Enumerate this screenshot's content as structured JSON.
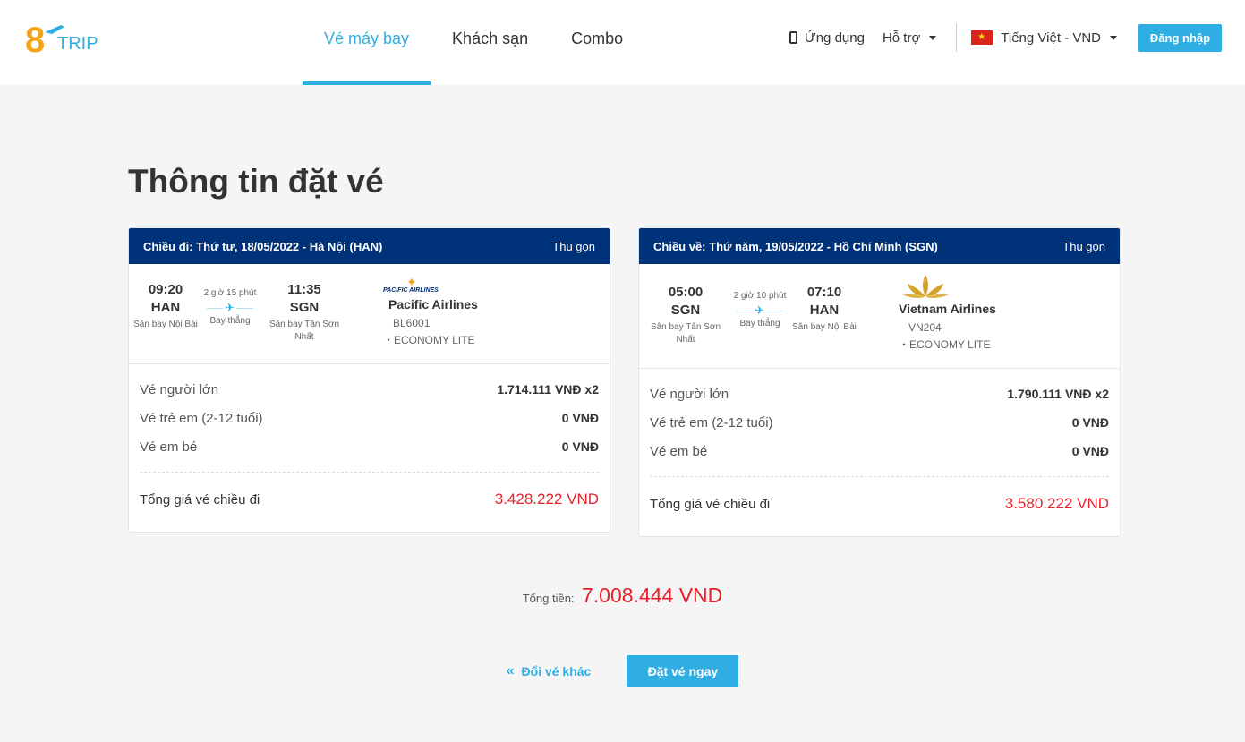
{
  "brand": {
    "logo_text": "8TRIP"
  },
  "nav": {
    "items": [
      {
        "label": "Vé máy bay",
        "active": true
      },
      {
        "label": "Khách sạn",
        "active": false
      },
      {
        "label": "Combo",
        "active": false
      }
    ]
  },
  "header": {
    "app_label": "Ứng dụng",
    "support_label": "Hỗ trợ",
    "language_label": "Tiếng Việt - VND",
    "login_label": "Đăng nhập"
  },
  "page_title": "Thông tin đặt vé",
  "outbound": {
    "header_title": "Chiều đi: Thứ tư, 18/05/2022 - Hà Nội (HAN)",
    "collapse_label": "Thu gọn",
    "depart": {
      "time": "09:20",
      "code": "HAN",
      "airport": "Sân bay Nội Bài"
    },
    "duration": "2 giờ 15 phút",
    "stops": "Bay thẳng",
    "arrive": {
      "time": "11:35",
      "code": "SGN",
      "airport": "Sân bay Tân Sơn Nhất"
    },
    "airline": "Pacific Airlines",
    "airline_logo_text": "PACIFIC AIRLINES",
    "flight_no": "BL6001",
    "fare_class": "・ECONOMY LITE",
    "prices": [
      {
        "label": "Vé người lớn",
        "value": "1.714.111 VNĐ x2"
      },
      {
        "label": "Vé trẻ em (2-12 tuổi)",
        "value": "0 VNĐ"
      },
      {
        "label": "Vé em bé",
        "value": "0 VNĐ"
      }
    ],
    "total_label": "Tổng giá vé chiều đi",
    "total_value": "3.428.222 VND"
  },
  "inbound": {
    "header_title": "Chiều về: Thứ năm, 19/05/2022 - Hồ Chí Minh (SGN)",
    "collapse_label": "Thu gọn",
    "depart": {
      "time": "05:00",
      "code": "SGN",
      "airport": "Sân bay Tân Sơn Nhất"
    },
    "duration": "2 giờ 10 phút",
    "stops": "Bay thẳng",
    "arrive": {
      "time": "07:10",
      "code": "HAN",
      "airport": "Sân bay Nội Bài"
    },
    "airline": "Vietnam Airlines",
    "flight_no": "VN204",
    "fare_class": "・ECONOMY LITE",
    "prices": [
      {
        "label": "Vé người lớn",
        "value": "1.790.111 VNĐ x2"
      },
      {
        "label": "Vé trẻ em (2-12 tuổi)",
        "value": "0 VNĐ"
      },
      {
        "label": "Vé em bé",
        "value": "0 VNĐ"
      }
    ],
    "total_label": "Tổng giá vé chiều đi",
    "total_value": "3.580.222 VND"
  },
  "grand_total": {
    "label": "Tổng tiền:",
    "value": "7.008.444 VND"
  },
  "actions": {
    "back_label": "Đổi vé khác",
    "book_label": "Đặt vé ngay"
  },
  "colors": {
    "accent": "#2eaee3",
    "header_bar": "#003279",
    "price_red": "#e8202a",
    "brand_orange": "#f5a31a"
  }
}
